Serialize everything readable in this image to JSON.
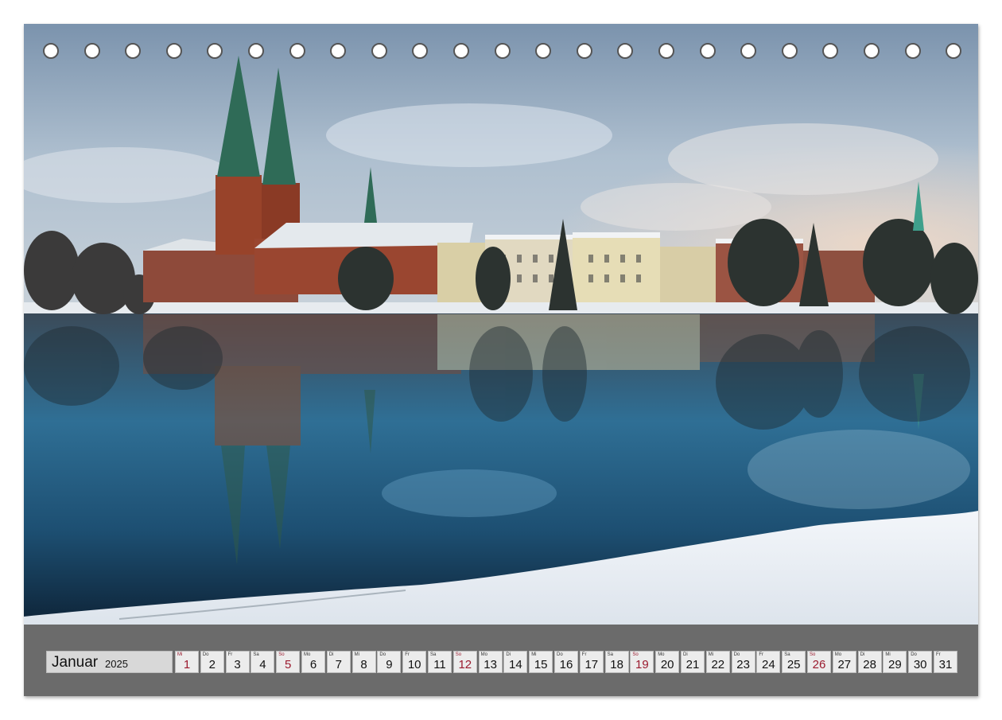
{
  "calendar": {
    "month": "Januar",
    "year": "2025",
    "days": [
      {
        "wd": "Mi",
        "d": "1",
        "sun": true
      },
      {
        "wd": "Do",
        "d": "2"
      },
      {
        "wd": "Fr",
        "d": "3"
      },
      {
        "wd": "Sa",
        "d": "4"
      },
      {
        "wd": "So",
        "d": "5",
        "sun": true
      },
      {
        "wd": "Mo",
        "d": "6"
      },
      {
        "wd": "Di",
        "d": "7"
      },
      {
        "wd": "Mi",
        "d": "8"
      },
      {
        "wd": "Do",
        "d": "9"
      },
      {
        "wd": "Fr",
        "d": "10"
      },
      {
        "wd": "Sa",
        "d": "11"
      },
      {
        "wd": "So",
        "d": "12",
        "sun": true
      },
      {
        "wd": "Mo",
        "d": "13"
      },
      {
        "wd": "Di",
        "d": "14"
      },
      {
        "wd": "Mi",
        "d": "15"
      },
      {
        "wd": "Do",
        "d": "16"
      },
      {
        "wd": "Fr",
        "d": "17"
      },
      {
        "wd": "Sa",
        "d": "18"
      },
      {
        "wd": "So",
        "d": "19",
        "sun": true
      },
      {
        "wd": "Mo",
        "d": "20"
      },
      {
        "wd": "Di",
        "d": "21"
      },
      {
        "wd": "Mi",
        "d": "22"
      },
      {
        "wd": "Do",
        "d": "23"
      },
      {
        "wd": "Fr",
        "d": "24"
      },
      {
        "wd": "Sa",
        "d": "25"
      },
      {
        "wd": "So",
        "d": "26",
        "sun": true
      },
      {
        "wd": "Mo",
        "d": "27"
      },
      {
        "wd": "Di",
        "d": "28"
      },
      {
        "wd": "Mi",
        "d": "29"
      },
      {
        "wd": "Do",
        "d": "30"
      },
      {
        "wd": "Fr",
        "d": "31"
      }
    ]
  },
  "colors": {
    "sunday": "#9b1a2e",
    "strip": "#6b6b6b"
  }
}
